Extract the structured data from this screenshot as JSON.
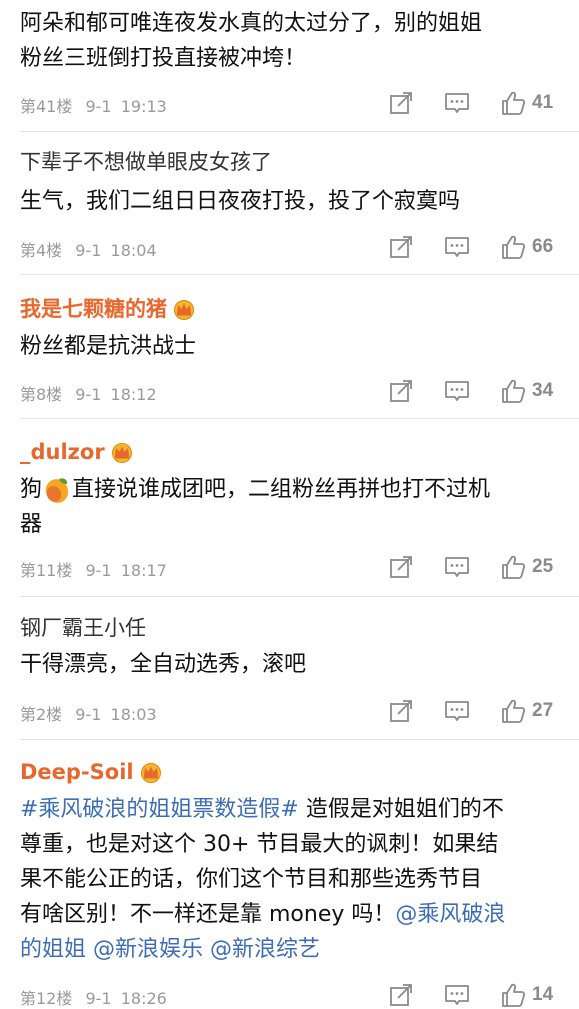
{
  "comments": [
    {
      "user": "",
      "lines": [
        "阿朵和郁可唯连夜发水真的太过分了，别的姐姐",
        "粉丝三班倒打投直接被冲垮！"
      ],
      "floor": "第41楼",
      "date": "9-1",
      "time": "19:13",
      "likes": "41"
    },
    {
      "user": "下辈子不想做单眼皮女孩了",
      "lines": [
        "生气，我们二组日日夜夜打投，投了个寂寞吗"
      ],
      "floor": "第4楼",
      "date": "9-1",
      "time": "18:04",
      "likes": "66"
    },
    {
      "user": "我是七颗糖的猪",
      "vip": true,
      "lines": [
        "粉丝都是抗洪战士"
      ],
      "floor": "第8楼",
      "date": "9-1",
      "time": "18:12",
      "likes": "34"
    },
    {
      "user": "_dulzor",
      "vip": true,
      "line1_a": "狗",
      "emoji": "mango-emoji",
      "line1_b": "直接说谁成团吧，二组粉丝再拼也打不过机",
      "line2": "器",
      "floor": "第11楼",
      "date": "9-1",
      "time": "18:17",
      "likes": "25"
    },
    {
      "user": "钢厂霸王小任",
      "lines": [
        "干得漂亮，全自动选秀，滚吧"
      ],
      "floor": "第2楼",
      "date": "9-1",
      "time": "18:03",
      "likes": "27"
    },
    {
      "user": "Deep-Soil",
      "vip": true,
      "hashtag": "#乘风破浪的姐姐票数造假#",
      "line1_rest": " 造假是对姐姐们的不",
      "line2": "尊重，也是对这个 30+ 节目最大的讽刺！如果结",
      "line3": "果不能公正的话，你们这个节目和那些选秀节目",
      "line4_a": "有啥区别！不一样还是靠 money 吗！",
      "mention1": "@乘风破浪",
      "line5_a": "的姐姐",
      "mention2": "@新浪娱乐",
      "mention3": "@新浪综艺",
      "floor": "第12楼",
      "date": "9-1",
      "time": "18:26",
      "likes": "14"
    }
  ],
  "icons": {
    "share": "share-edit-icon",
    "comment": "comment-icon",
    "like": "thumbs-up-icon",
    "crown": "vip-crown-icon"
  },
  "colors": {
    "vip_name": "#e8672d",
    "link": "#3d6db5",
    "meta": "#9a9a9a"
  }
}
